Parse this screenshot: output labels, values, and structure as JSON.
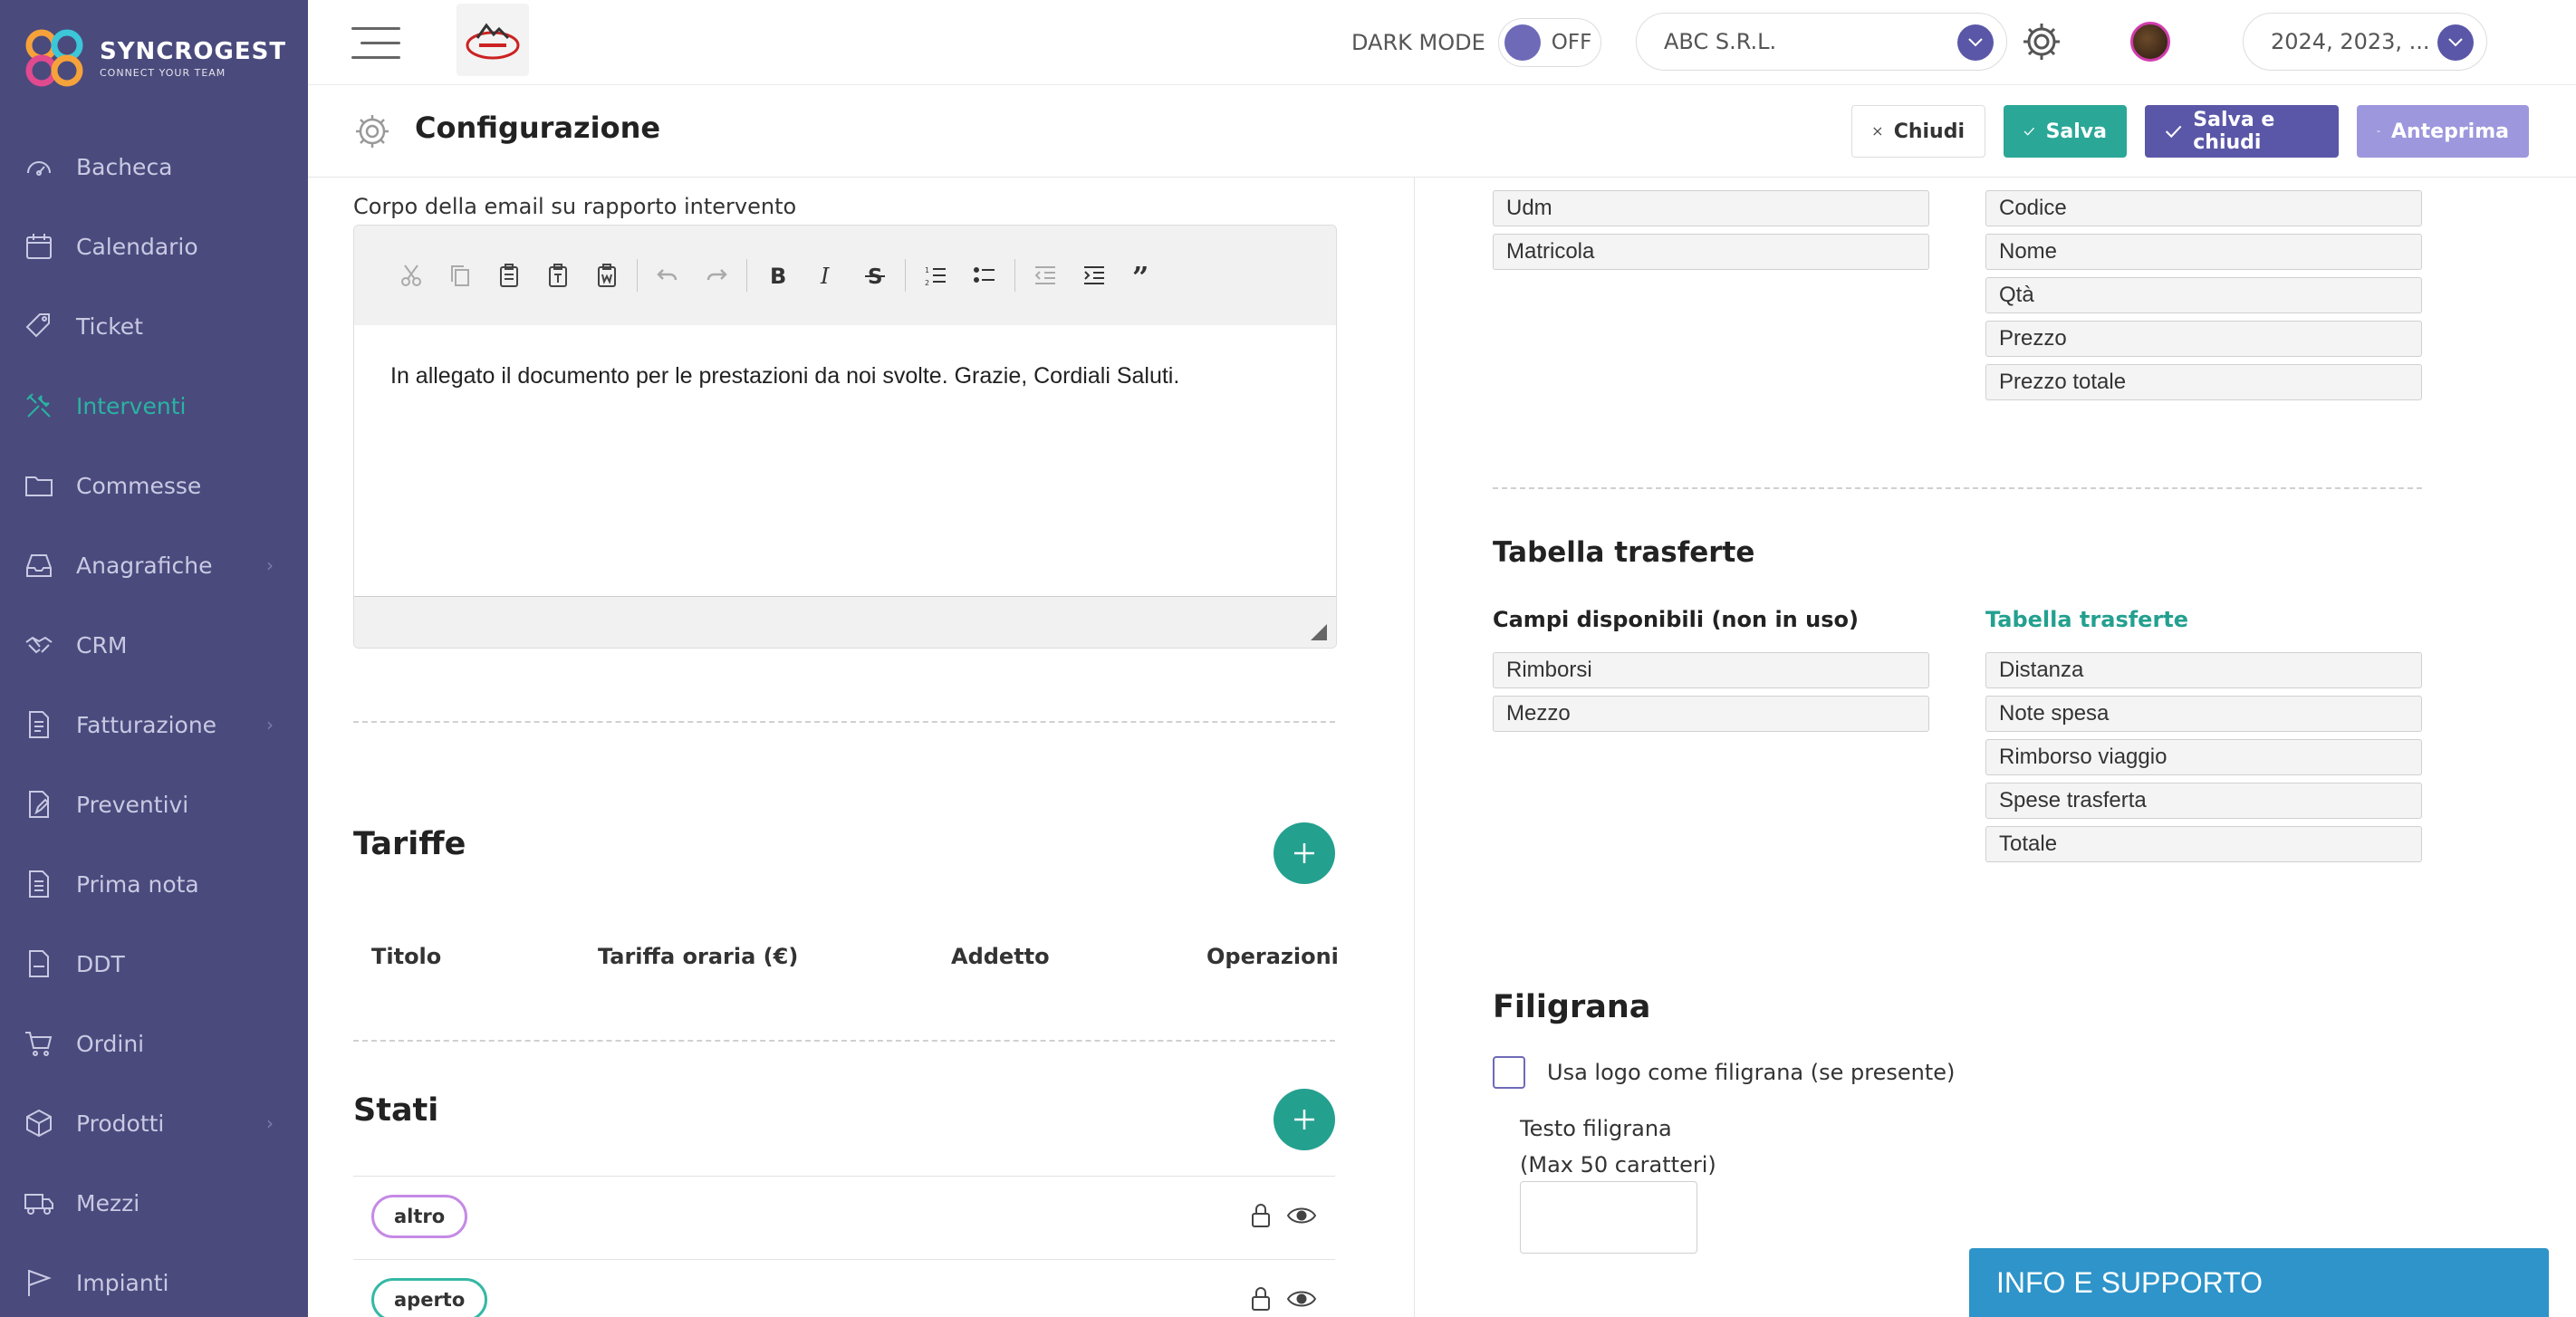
{
  "brand": {
    "name": "SYNCROGEST",
    "tagline": "CONNECT YOUR TEAM"
  },
  "sidebar": {
    "items": [
      {
        "label": "Bacheca",
        "icon": "dashboard-icon"
      },
      {
        "label": "Calendario",
        "icon": "calendar-icon"
      },
      {
        "label": "Ticket",
        "icon": "ticket-icon"
      },
      {
        "label": "Interventi",
        "icon": "tools-icon",
        "active": true
      },
      {
        "label": "Commesse",
        "icon": "folder-icon"
      },
      {
        "label": "Anagrafiche",
        "icon": "inbox-icon",
        "has_children": true
      },
      {
        "label": "CRM",
        "icon": "handshake-icon"
      },
      {
        "label": "Fatturazione",
        "icon": "invoice-icon",
        "has_children": true
      },
      {
        "label": "Preventivi",
        "icon": "quote-icon"
      },
      {
        "label": "Prima nota",
        "icon": "notes-icon"
      },
      {
        "label": "DDT",
        "icon": "ddt-icon"
      },
      {
        "label": "Ordini",
        "icon": "cart-icon"
      },
      {
        "label": "Prodotti",
        "icon": "box-icon",
        "has_children": true
      },
      {
        "label": "Mezzi",
        "icon": "truck-icon"
      },
      {
        "label": "Impianti",
        "icon": "flag-icon"
      }
    ]
  },
  "topbar": {
    "dark_mode_label": "DARK MODE",
    "dark_mode_state": "OFF",
    "company": "ABC S.R.L.",
    "years": "2024, 2023, ..."
  },
  "header": {
    "title": "Configurazione",
    "close_label": "Chiudi",
    "save_label": "Salva",
    "save_close_label": "Salva e chiudi",
    "preview_label": "Anteprima"
  },
  "email": {
    "label": "Corpo della email su rapporto intervento",
    "body": "In allegato il documento per le prestazioni da noi svolte. Grazie, Cordiali Saluti."
  },
  "tariffe": {
    "title": "Tariffe",
    "columns": [
      "Titolo",
      "Tariffa oraria (€)",
      "Addetto",
      "Operazioni"
    ]
  },
  "stati": {
    "title": "Stati",
    "items": [
      {
        "label": "altro",
        "color": "#c58ae6"
      },
      {
        "label": "aperto",
        "color": "#35b8a5"
      }
    ]
  },
  "materials": {
    "available": [
      "Udm",
      "Matricola"
    ],
    "table": [
      "Codice",
      "Nome",
      "Qtà",
      "Prezzo",
      "Prezzo totale"
    ]
  },
  "trasferte": {
    "title": "Tabella trasferte",
    "available_head": "Campi disponibili (non in uso)",
    "table_head": "Tabella trasferte",
    "available": [
      "Rimborsi",
      "Mezzo"
    ],
    "table": [
      "Distanza",
      "Note spesa",
      "Rimborso viaggio",
      "Spese trasferta",
      "Totale"
    ]
  },
  "filigrana": {
    "title": "Filigrana",
    "checkbox_label": "Usa logo come filigrana (se presente)",
    "text_label_1": "Testo filigrana",
    "text_label_2": "(Max 50 caratteri)",
    "text_value": ""
  },
  "support": {
    "label": "INFO E SUPPORTO"
  },
  "colors": {
    "sidebar": "#4a4a7d",
    "accent": "#2aa797",
    "primary": "#5a57a8",
    "preview": "#9d97dd",
    "support": "#2e94c9"
  }
}
